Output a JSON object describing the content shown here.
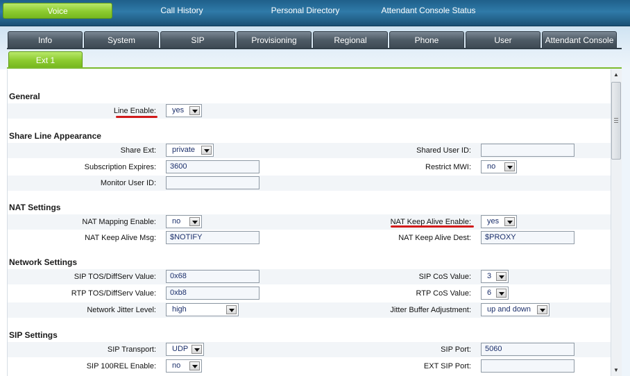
{
  "topnav": {
    "items": [
      "Voice",
      "Call History",
      "Personal Directory",
      "Attendant Console Status"
    ]
  },
  "tabs": [
    "Info",
    "System",
    "SIP",
    "Provisioning",
    "Regional",
    "Phone",
    "User",
    "Attendant Console"
  ],
  "subtab": "Ext 1",
  "icons": {
    "scroll_up": "triangle-up-icon",
    "scroll_down": "triangle-down-icon",
    "dropdown": "chevron-down-icon"
  },
  "colors": {
    "active_green": "#8ccb2f",
    "nav_blue": "#2f7aa8",
    "annotation_red": "#d11a1a"
  },
  "sections": {
    "general": {
      "title": "General",
      "line_enable": {
        "label": "Line Enable:",
        "value": "yes"
      }
    },
    "share_line": {
      "title": "Share Line Appearance",
      "share_ext": {
        "label": "Share Ext:",
        "value": "private"
      },
      "shared_user_id": {
        "label": "Shared User ID:",
        "value": ""
      },
      "subscription_expires": {
        "label": "Subscription Expires:",
        "value": "3600"
      },
      "restrict_mwi": {
        "label": "Restrict MWI:",
        "value": "no"
      },
      "monitor_user_id": {
        "label": "Monitor User ID:",
        "value": ""
      }
    },
    "nat": {
      "title": "NAT Settings",
      "nat_mapping_enable": {
        "label": "NAT Mapping Enable:",
        "value": "no"
      },
      "nat_keep_alive_enable": {
        "label": "NAT Keep Alive Enable:",
        "value": "yes"
      },
      "nat_keep_alive_msg": {
        "label": "NAT Keep Alive Msg:",
        "value": "$NOTIFY"
      },
      "nat_keep_alive_dest": {
        "label": "NAT Keep Alive Dest:",
        "value": "$PROXY"
      }
    },
    "network": {
      "title": "Network Settings",
      "sip_tos": {
        "label": "SIP TOS/DiffServ Value:",
        "value": "0x68"
      },
      "sip_cos": {
        "label": "SIP CoS Value:",
        "value": "3"
      },
      "rtp_tos": {
        "label": "RTP TOS/DiffServ Value:",
        "value": "0xb8"
      },
      "rtp_cos": {
        "label": "RTP CoS Value:",
        "value": "6"
      },
      "jitter_level": {
        "label": "Network Jitter Level:",
        "value": "high"
      },
      "jitter_adjust": {
        "label": "Jitter Buffer Adjustment:",
        "value": "up and down"
      }
    },
    "sip": {
      "title": "SIP Settings",
      "sip_transport": {
        "label": "SIP Transport:",
        "value": "UDP"
      },
      "sip_port": {
        "label": "SIP Port:",
        "value": "5060"
      },
      "sip_100rel": {
        "label": "SIP 100REL Enable:",
        "value": "no"
      },
      "ext_sip_port": {
        "label": "EXT SIP Port:",
        "value": ""
      }
    }
  }
}
